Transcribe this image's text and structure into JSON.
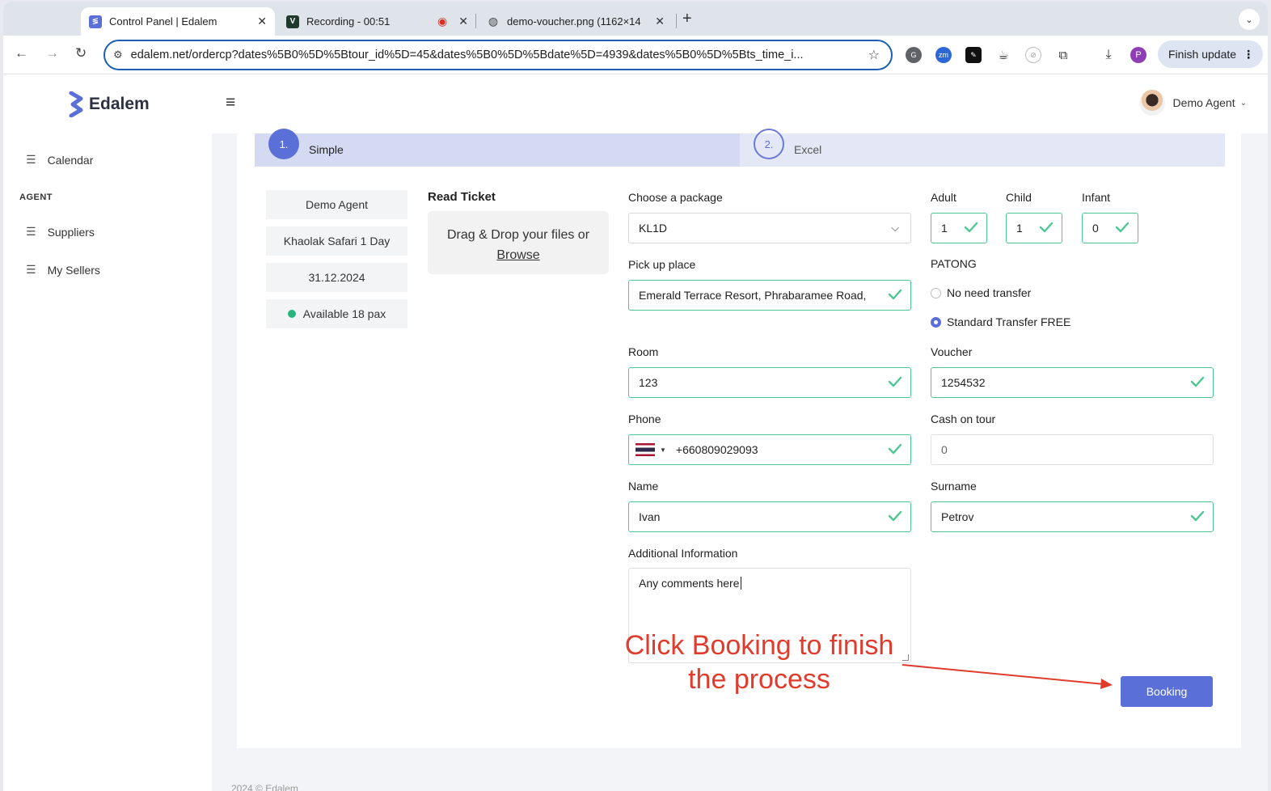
{
  "browser": {
    "tabs": [
      {
        "title": "Control Panel | Edalem",
        "icon": "edalem-icon"
      },
      {
        "title": "Recording - 00:51",
        "icon": "v-icon"
      },
      {
        "title": "demo-voucher.png (1162×14",
        "icon": "globe-icon"
      }
    ],
    "url": "edalem.net/ordercp?dates%5B0%5D%5Btour_id%5D=45&dates%5B0%5D%5Bdate%5D=4939&dates%5B0%5D%5Bts_time_i...",
    "finish_update": "Finish update",
    "profile_initial": "P"
  },
  "app": {
    "logo": "Edalem",
    "user_name": "Demo Agent",
    "accent": "#5a6fd8",
    "valid_color": "#4cc792"
  },
  "sidebar": {
    "items": [
      {
        "label": "Calendar"
      },
      {
        "label": "Suppliers"
      },
      {
        "label": "My Sellers"
      }
    ],
    "section": "AGENT"
  },
  "steps": [
    {
      "num": "1.",
      "label": "Simple"
    },
    {
      "num": "2.",
      "label": "Excel"
    }
  ],
  "summary": {
    "agent": "Demo Agent",
    "tour": "Khaolak Safari 1 Day",
    "date": "31.12.2024",
    "availability": "Available 18 pax"
  },
  "ticket": {
    "title": "Read Ticket",
    "drop_text": "Drag & Drop your files or",
    "browse": "Browse"
  },
  "form": {
    "package_label": "Choose a package",
    "package_value": "KL1D",
    "adult_label": "Adult",
    "adult_value": "1",
    "child_label": "Child",
    "child_value": "1",
    "infant_label": "Infant",
    "infant_value": "0",
    "pickup_label": "Pick up place",
    "pickup_value": "Emerald Terrace Resort, Phrabaramee Road,",
    "area_label": "PATONG",
    "transfer_options": [
      "No need transfer",
      "Standard Transfer FREE"
    ],
    "transfer_selected": "Standard Transfer FREE",
    "room_label": "Room",
    "room_value": "123",
    "voucher_label": "Voucher",
    "voucher_value": "1254532",
    "phone_label": "Phone",
    "phone_value": "+660809029093",
    "cash_label": "Cash on tour",
    "cash_value": "0",
    "name_label": "Name",
    "name_value": "Ivan",
    "surname_label": "Surname",
    "surname_value": "Petrov",
    "additional_label": "Additional Information",
    "additional_value": "Any comments here",
    "booking_button": "Booking"
  },
  "annotation": {
    "text": "Click Booking to finish the process",
    "color": "#e03c2d"
  },
  "footer": "2024 © Edalem"
}
